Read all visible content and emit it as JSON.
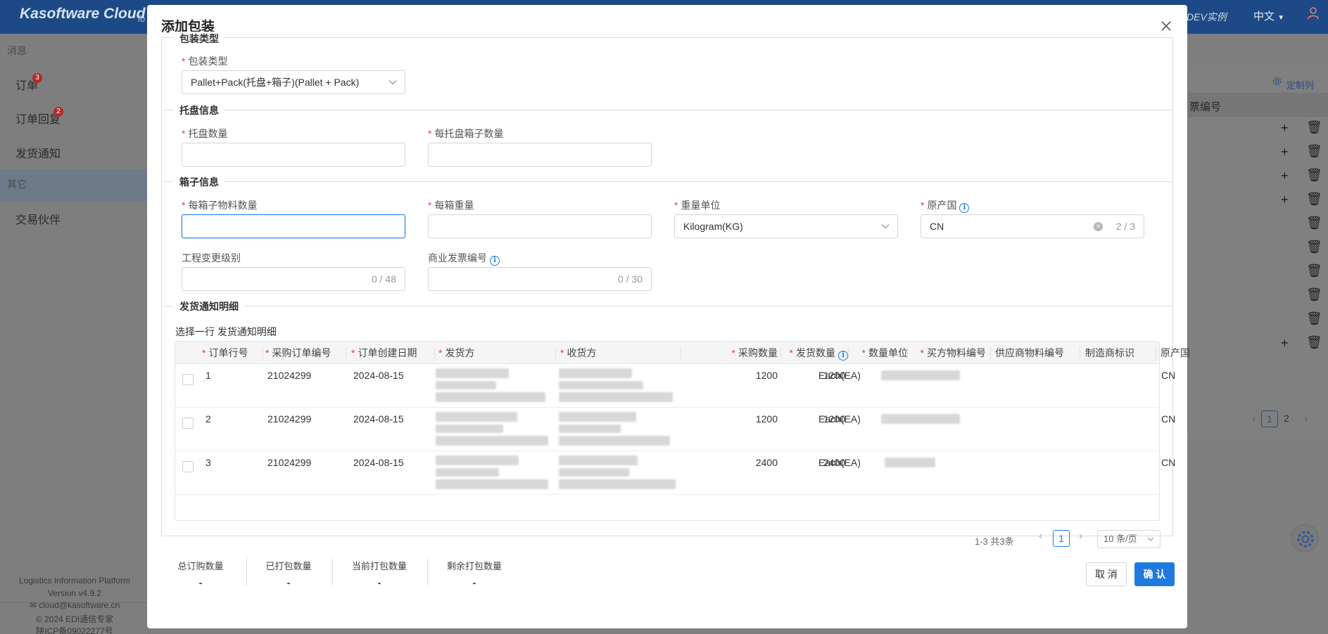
{
  "app": {
    "brand": "Kasoftware Cloud",
    "brand_sub": "fo",
    "top_right_1": "DEV实例",
    "top_right_2": "中文",
    "sidebar": {
      "group1": "消息",
      "items1": [
        {
          "label": "订单",
          "badge": "3"
        },
        {
          "label": "订单回复",
          "badge": "2"
        },
        {
          "label": "发货通知",
          "badge": ""
        }
      ],
      "group2": "其它",
      "items2": [
        {
          "label": "交易伙伴"
        }
      ]
    },
    "footer": {
      "line1": "Logistics Information Platform",
      "line2": "Version v4.9.2",
      "line3": "cloud@kasoftware.cn",
      "line4": "© 2024 EDI通信专家",
      "line5": "陕ICP备09022277号"
    },
    "right_panel": {
      "custom_columns": "定制列",
      "col_header": "票编号",
      "pages": [
        "1",
        "2"
      ]
    }
  },
  "modal": {
    "title": "添加包装",
    "sections": {
      "package_type": "包装类型",
      "pallet_info": "托盘信息",
      "box_info": "箱子信息",
      "detail": "发货通知明细"
    },
    "fields": {
      "package_type": {
        "label": "包装类型",
        "value": "Pallet+Pack(托盘+箱子)(Pallet + Pack)"
      },
      "pallet_count": {
        "label": "托盘数量",
        "value": ""
      },
      "boxes_per_pallet": {
        "label": "每托盘箱子数量",
        "value": ""
      },
      "items_per_box": {
        "label": "每箱子物料数量",
        "value": ""
      },
      "weight_per_box": {
        "label": "每箱重量",
        "value": ""
      },
      "weight_unit": {
        "label": "重量单位",
        "value": "Kilogram(KG)"
      },
      "origin_country": {
        "label": "原产国",
        "value": "CN",
        "counter": "2 / 3"
      },
      "eng_change_level": {
        "label": "工程变更级别",
        "value": "",
        "counter": "0 / 48"
      },
      "commercial_invoice": {
        "label": "商业发票编号",
        "value": "",
        "counter": "0 / 30"
      }
    },
    "detail_caption": "选择一行 发货通知明细",
    "table": {
      "columns": [
        "订单行号",
        "采购订单编号",
        "订单创建日期",
        "发货方",
        "收货方",
        "采购数量",
        "发货数量",
        "数量单位",
        "买方物料编号",
        "供应商物料编号",
        "制造商标识",
        "原产国"
      ],
      "rows": [
        {
          "line": "1",
          "po": "21024299",
          "date": "2024-08-15",
          "qty": "1200",
          "ship_qty": "1200",
          "unit": "Each(EA)",
          "origin": "CN"
        },
        {
          "line": "2",
          "po": "21024299",
          "date": "2024-08-15",
          "qty": "1200",
          "ship_qty": "1200",
          "unit": "Each(EA)",
          "origin": "CN"
        },
        {
          "line": "3",
          "po": "21024299",
          "date": "2024-08-15",
          "qty": "2400",
          "ship_qty": "2400",
          "unit": "Each(EA)",
          "origin": "CN"
        }
      ],
      "pagination": {
        "total": "1-3 共3条",
        "page": "1",
        "page_size": "10 条/页"
      }
    },
    "stats": [
      {
        "label": "总订购数量",
        "value": "-"
      },
      {
        "label": "已打包数量",
        "value": "-"
      },
      {
        "label": "当前打包数量",
        "value": "-"
      },
      {
        "label": "剩余打包数量",
        "value": "-"
      }
    ],
    "buttons": {
      "cancel": "取 消",
      "ok": "确 认"
    }
  }
}
